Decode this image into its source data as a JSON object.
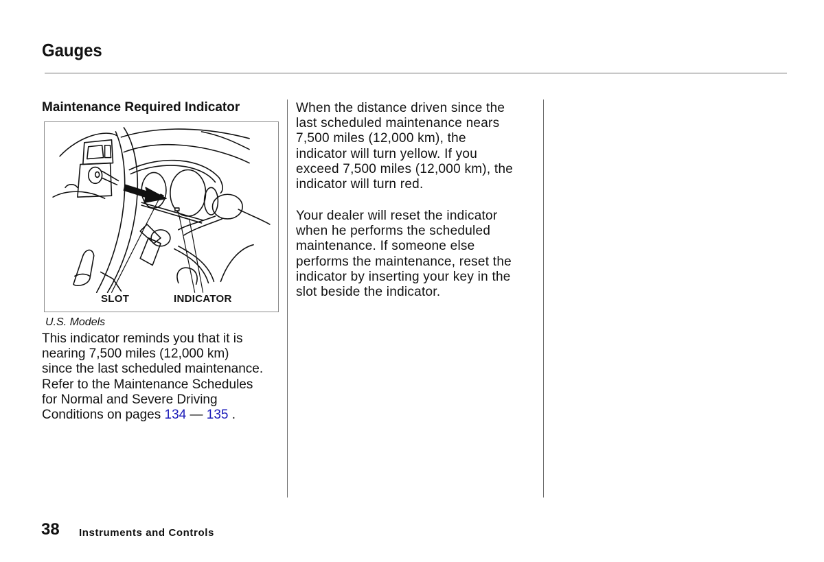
{
  "page": {
    "title": "Gauges"
  },
  "section": {
    "heading": "Maintenance Required Indicator",
    "figure": {
      "labels": {
        "slot": "SLOT",
        "indicator": "INDICATOR"
      },
      "caption": "U.S. Models"
    },
    "left_paragraph": {
      "lines": [
        "This indicator reminds you that it is",
        "nearing 7,500 miles (12,000 km)",
        "since the last scheduled maintenance.",
        "Refer to the Maintenance Schedules",
        "for Normal and Severe Driving"
      ],
      "last_line_prefix": "Conditions on pages ",
      "link_start_page": "134",
      "range_separator": " — ",
      "link_end_page": "135",
      "last_line_suffix": " ."
    },
    "middle_paragraph_1": {
      "lines": [
        "When the distance driven since the",
        "last scheduled maintenance nears",
        "7,500 miles (12,000 km), the",
        "indicator will turn yellow. If you",
        "exceed 7,500 miles (12,000 km), the",
        "indicator will turn red."
      ]
    },
    "middle_paragraph_2": {
      "lines": [
        "Your dealer will reset the indicator",
        "when he performs the scheduled",
        "maintenance. If someone else",
        "performs the maintenance, reset the",
        "indicator by inserting your key in the",
        "slot beside the indicator."
      ]
    }
  },
  "footer": {
    "page_number": "38",
    "section_name": "Instruments and Controls"
  },
  "colors": {
    "link": "#1a1ab8",
    "text": "#111111",
    "rule": "#6e6e6e"
  }
}
